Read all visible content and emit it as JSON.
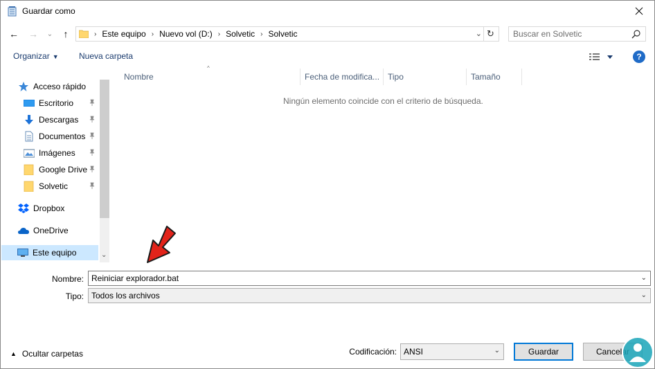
{
  "window": {
    "title": "Guardar como",
    "close": "✕"
  },
  "nav": {
    "back": "←",
    "forward": "→",
    "recent": "⌄",
    "up": "↑",
    "breadcrumb": [
      "Este equipo",
      "Nuevo vol (D:)",
      "Solvetic",
      "Solvetic"
    ],
    "breadcrumb_sep": "›",
    "dropdown": "⌄",
    "refresh": "↻"
  },
  "search": {
    "placeholder": "Buscar en Solvetic"
  },
  "toolbar": {
    "organize": "Organizar",
    "new_folder": "Nueva carpeta",
    "help": "?"
  },
  "sidebar": {
    "items": [
      {
        "label": "Acceso rápido",
        "icon": "star-icon"
      },
      {
        "label": "Escritorio",
        "icon": "desktop-icon",
        "pinned": true
      },
      {
        "label": "Descargas",
        "icon": "download-icon",
        "pinned": true
      },
      {
        "label": "Documentos",
        "icon": "documents-icon",
        "pinned": true
      },
      {
        "label": "Imágenes",
        "icon": "pictures-icon",
        "pinned": true
      },
      {
        "label": "Google Drive",
        "icon": "folder-icon",
        "pinned": true
      },
      {
        "label": "Solvetic",
        "icon": "folder-icon",
        "pinned": true
      },
      {
        "label": "Dropbox",
        "icon": "dropbox-icon"
      },
      {
        "label": "OneDrive",
        "icon": "onedrive-icon"
      },
      {
        "label": "Este equipo",
        "icon": "computer-icon",
        "selected": true
      }
    ],
    "pin_glyph": "📌",
    "scroll_down": "⌄"
  },
  "content": {
    "columns": [
      "Nombre",
      "Fecha de modifica...",
      "Tipo",
      "Tamaño"
    ],
    "sort_glyph": "^",
    "empty_message": "Ningún elemento coincide con el criterio de búsqueda."
  },
  "form": {
    "name_label": "Nombre:",
    "name_value": "Reiniciar explorador.bat",
    "type_label": "Tipo:",
    "type_value": "Todos los archivos",
    "dropdown": "⌄"
  },
  "bottom": {
    "hide_folders": "Ocultar carpetas",
    "hide_caret": "▲",
    "encoding_label": "Codificación:",
    "encoding_value": "ANSI",
    "save": "Guardar",
    "cancel": "Cancelar"
  },
  "colors": {
    "accent": "#0078d7",
    "selected_bg": "#cce8ff",
    "link": "#1a3b6e",
    "annotation_arrow": "#e2231a",
    "watermark": "#1aa5b8"
  }
}
